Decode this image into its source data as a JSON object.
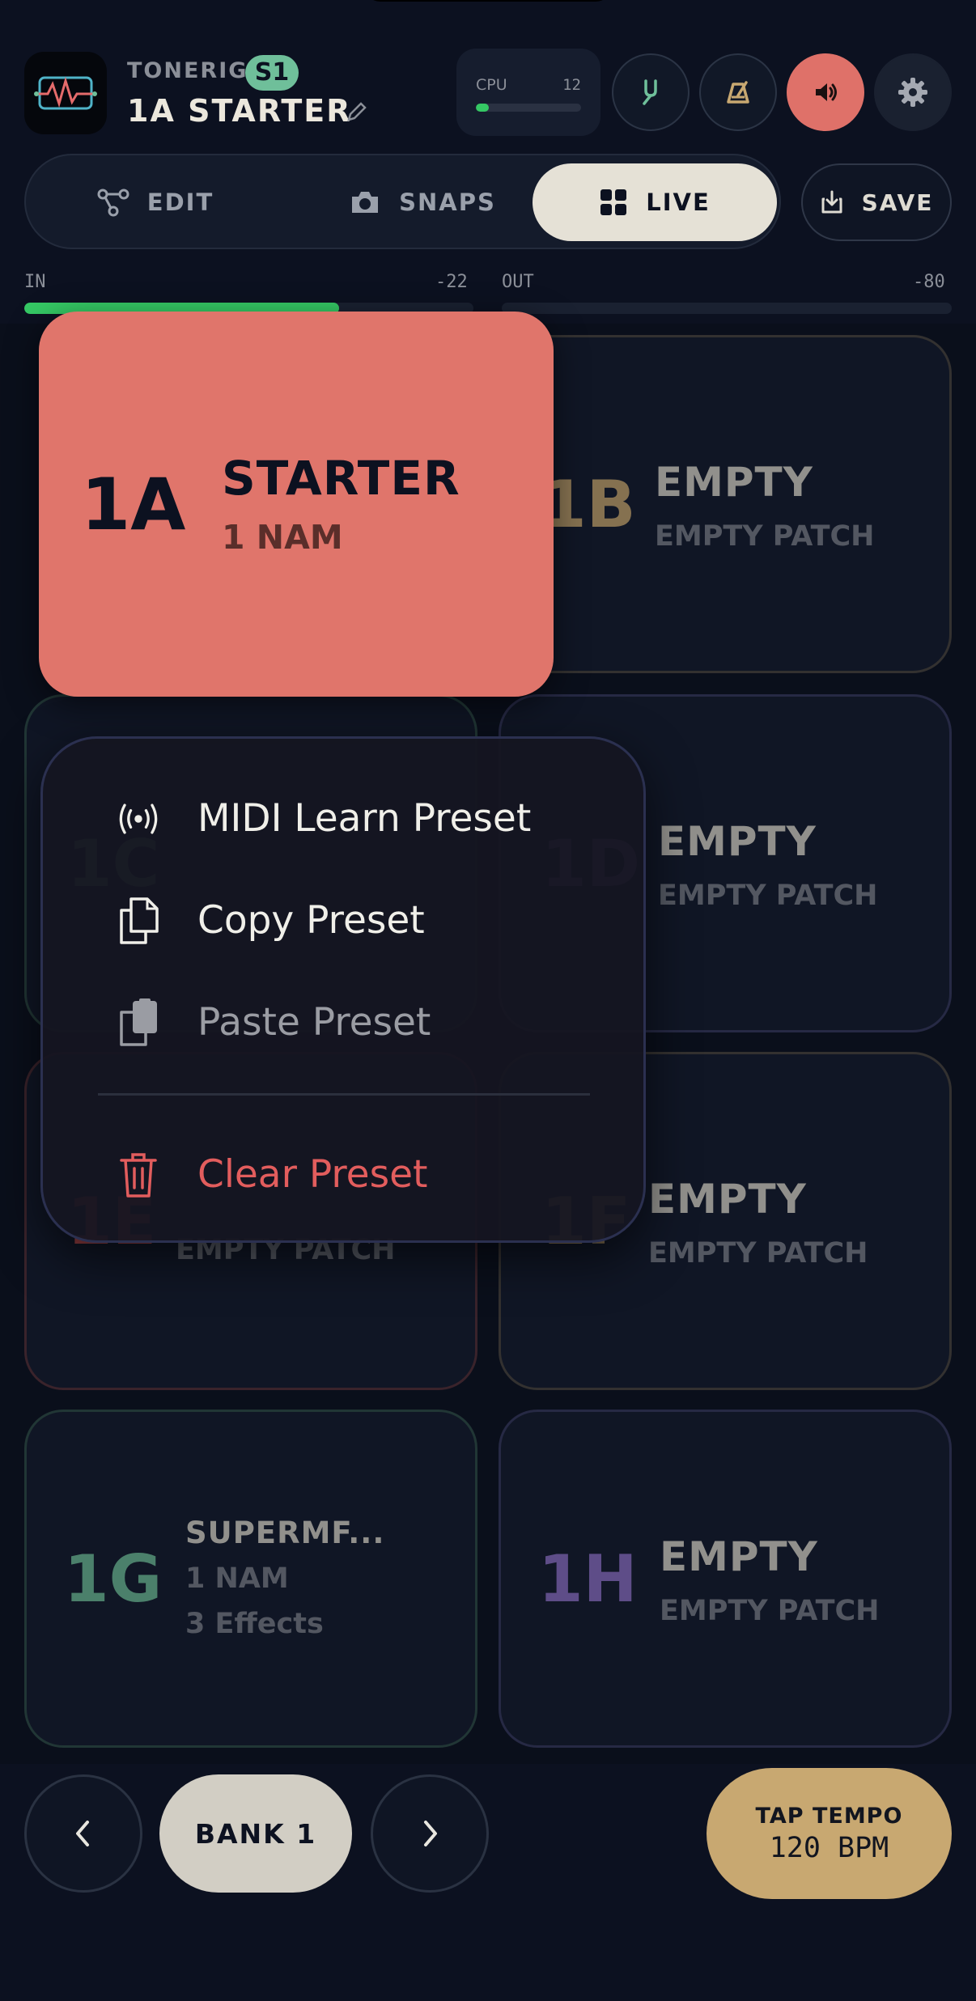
{
  "header": {
    "brand": "TONERIG",
    "slot_badge": "S1",
    "preset_title": "1A STARTER",
    "cpu_label": "CPU",
    "cpu_value": "12",
    "cpu_level": 0.12,
    "buttons": [
      "tuner-icon",
      "metronome-icon",
      "speaker-icon",
      "gear-icon"
    ]
  },
  "modes": {
    "tabs": [
      {
        "label": "EDIT",
        "icon": "nodes-icon"
      },
      {
        "label": "SNAPS",
        "icon": "camera-icon"
      },
      {
        "label": "LIVE",
        "icon": "grid-icon",
        "active": true
      }
    ],
    "save_label": "SAVE"
  },
  "meters": {
    "in_label": "IN",
    "in_value": "-22",
    "in_level": 0.7,
    "out_label": "OUT",
    "out_value": "-80",
    "out_level": 0.0
  },
  "presets": [
    {
      "code": "1A",
      "name": "STARTER",
      "sub": "1 NAM",
      "color": "#0c1120",
      "active": true
    },
    {
      "code": "1B",
      "name": "EMPTY",
      "sub": "EMPTY PATCH",
      "color": "#c8a871"
    },
    {
      "code": "1C",
      "name": "",
      "sub": "",
      "color": "#6fbf9a"
    },
    {
      "code": "1D",
      "name": "EMPTY",
      "sub": "EMPTY PATCH",
      "color": "#8d70c6"
    },
    {
      "code": "1E",
      "name": "",
      "sub": "EMPTY PATCH",
      "color": "#df5a5a"
    },
    {
      "code": "1F",
      "name": "EMPTY",
      "sub": "EMPTY PATCH",
      "color": "#c8a871"
    },
    {
      "code": "1G",
      "name": "SUPERMF...",
      "sub": "1 NAM",
      "sub2": "3 Effects",
      "color": "#6fbf9a"
    },
    {
      "code": "1H",
      "name": "EMPTY",
      "sub": "EMPTY PATCH",
      "color": "#8d70c6"
    }
  ],
  "context_menu": {
    "items": [
      {
        "label": "MIDI Learn Preset",
        "icon": "broadcast-icon"
      },
      {
        "label": "Copy Preset",
        "icon": "copy-icon"
      },
      {
        "label": "Paste Preset",
        "icon": "paste-icon",
        "disabled": true
      },
      {
        "label": "Clear Preset",
        "icon": "trash-icon",
        "danger": true
      }
    ]
  },
  "footer": {
    "bank_label": "BANK 1",
    "tap_label": "TAP TEMPO",
    "tap_bpm": "120 BPM"
  },
  "colors": {
    "accent_green": "#35c864",
    "active_tile": "#e0756b",
    "danger": "#e25d5d",
    "tap": "#c8a871"
  }
}
